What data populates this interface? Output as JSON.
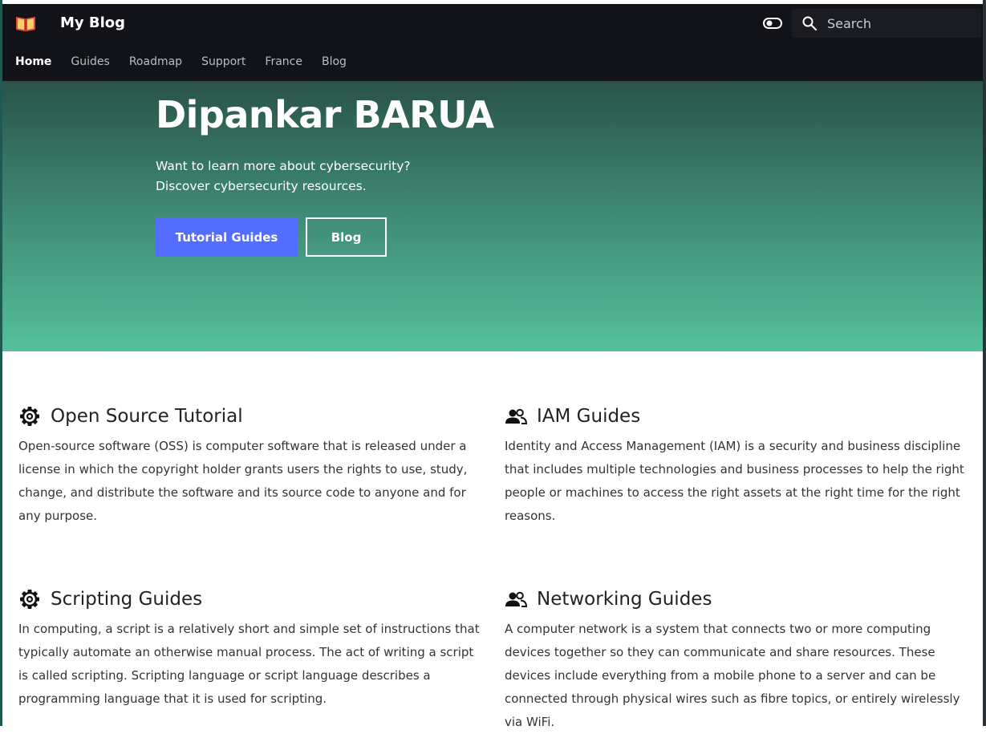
{
  "header": {
    "site_title": "My Blog",
    "logo_icon": "book-icon",
    "theme_toggle_icon": "toggle-icon",
    "search": {
      "placeholder": "Search",
      "icon": "search-icon"
    }
  },
  "nav": {
    "items": [
      {
        "label": "Home",
        "active": true
      },
      {
        "label": "Guides",
        "active": false
      },
      {
        "label": "Roadmap",
        "active": false
      },
      {
        "label": "Support",
        "active": false
      },
      {
        "label": "France",
        "active": false
      },
      {
        "label": "Blog",
        "active": false
      }
    ]
  },
  "hero": {
    "title": "Dipankar BARUA",
    "subtitle": "Want to learn more about cybersecurity? Discover cybersecurity resources.",
    "primary_button": "Tutorial Guides",
    "secondary_button": "Blog",
    "colors": {
      "top": "#2a5249",
      "bottom": "#55c09c",
      "primary_button": "#536dfe"
    }
  },
  "features": [
    {
      "icon": "gear-icon",
      "title": "Open Source Tutorial",
      "description": "Open-source software (OSS) is computer software that is released under a license in which the copyright holder grants users the rights to use, study, change, and distribute the software and its source code to anyone and for any purpose."
    },
    {
      "icon": "users-icon",
      "title": "IAM Guides",
      "description": "Identity and Access Management (IAM) is a security and business discipline that includes multiple technologies and business processes to help the right people or machines to access the right assets at the right time for the right reasons."
    },
    {
      "icon": "gear-icon",
      "title": "Scripting Guides",
      "description": "In computing, a script is a relatively short and simple set of instructions that typically automate an otherwise manual process. The act of writing a script is called scripting. Scripting language or script language describes a programming language that it is used for scripting."
    },
    {
      "icon": "users-icon",
      "title": "Networking Guides",
      "description": "A computer network is a system that connects two or more computing devices together so they can communicate and share resources. These devices include everything from a mobile phone to a server and can be connected through physical wires such as fibre topics, or entirely wirelessly via WiFi."
    }
  ]
}
